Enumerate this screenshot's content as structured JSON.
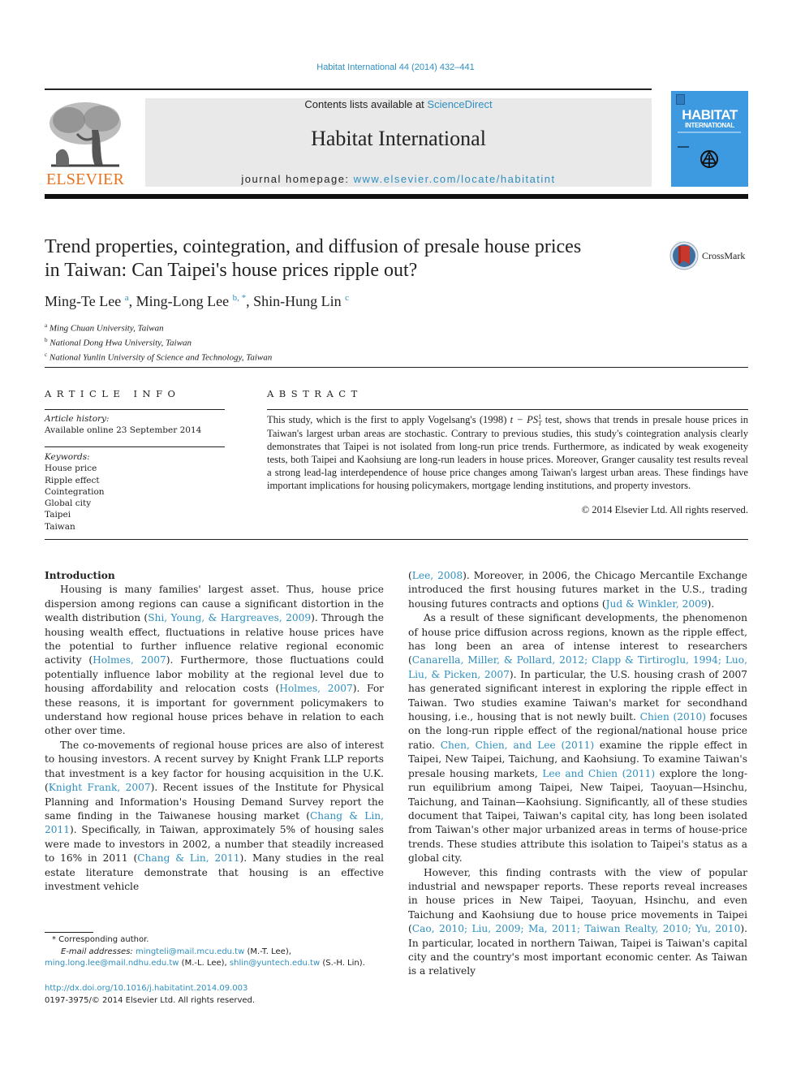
{
  "header": {
    "citation": "Habitat International 44 (2014) 432–441",
    "contents_prefix": "Contents lists available at ",
    "contents_link": "ScienceDirect",
    "journal_name": "Habitat International",
    "homepage_prefix": "journal homepage: ",
    "homepage_link": "www.elsevier.com/locate/habitatint",
    "publisher_logo": "ELSEVIER",
    "cover": {
      "title": "HABITAT",
      "subtitle": "INTERNATIONAL"
    }
  },
  "article": {
    "title": "Trend properties, cointegration, and diffusion of presale house prices in Taiwan: Can Taipei's house prices ripple out?",
    "crossmark_label": "CrossMark",
    "authors": [
      {
        "name": "Ming-Te Lee",
        "sup": "a"
      },
      {
        "name": "Ming-Long Lee",
        "sup": "b, *"
      },
      {
        "name": "Shin-Hung Lin",
        "sup": "c"
      }
    ],
    "affiliations": [
      {
        "sup": "a",
        "text": "Ming Chuan University, Taiwan"
      },
      {
        "sup": "b",
        "text": "National Dong Hwa University, Taiwan"
      },
      {
        "sup": "c",
        "text": "National Yunlin University of Science and Technology, Taiwan"
      }
    ]
  },
  "article_info": {
    "heading": "ARTICLE INFO",
    "history_label": "Article history:",
    "history_value": "Available online 23 September 2014",
    "keywords_label": "Keywords:",
    "keywords": [
      "House price",
      "Ripple effect",
      "Cointegration",
      "Global city",
      "Taipei",
      "Taiwan"
    ]
  },
  "abstract": {
    "heading": "ABSTRACT",
    "text_before": "This study, which is the first to apply Vogelsang's (1998) ",
    "math": "t − PS",
    "math_sup": "1",
    "math_sub": "T",
    "text_after": " test, shows that trends in presale house prices in Taiwan's largest urban areas are stochastic. Contrary to previous studies, this study's cointegration analysis clearly demonstrates that Taipei is not isolated from long-run price trends. Furthermore, as indicated by weak exogeneity tests, both Taipei and Kaohsiung are long-run leaders in house prices. Moreover, Granger causality test results reveal a strong lead-lag interdependence of house price changes among Taiwan's largest urban areas. These findings have important implications for housing policymakers, mortgage lending institutions, and property investors.",
    "copyright": "© 2014 Elsevier Ltd. All rights reserved."
  },
  "body": {
    "intro_heading": "Introduction",
    "p1": [
      {
        "t": "Housing is many families' largest asset. Thus, house price dispersion among regions can cause a significant distortion in the wealth distribution ("
      },
      {
        "l": "Shi, Young, & Hargreaves, 2009"
      },
      {
        "t": "). Through the housing wealth effect, fluctuations in relative house prices have the potential to further influence relative regional economic activity ("
      },
      {
        "l": "Holmes, 2007"
      },
      {
        "t": "). Furthermore, those fluctuations could potentially influence labor mobility at the regional level due to housing affordability and relocation costs ("
      },
      {
        "l": "Holmes, 2007"
      },
      {
        "t": "). For these reasons, it is important for government policymakers to understand how regional house prices behave in relation to each other over time."
      }
    ],
    "p2": [
      {
        "t": "The co-movements of regional house prices are also of interest to housing investors. A recent survey by Knight Frank LLP reports that investment is a key factor for housing acquisition in the U.K. ("
      },
      {
        "l": "Knight Frank, 2007"
      },
      {
        "t": "). Recent issues of the Institute for Physical Planning and Information's Housing Demand Survey report the same finding in the Taiwanese housing market ("
      },
      {
        "l": "Chang & Lin, 2011"
      },
      {
        "t": "). Specifically, in Taiwan, approximately 5% of housing sales were made to investors in 2002, a number that steadily increased to 16% in 2011 ("
      },
      {
        "l": "Chang & Lin, 2011"
      },
      {
        "t": "). Many studies in the real estate literature demonstrate that housing is an effective investment vehicle"
      }
    ],
    "p3": [
      {
        "t": "("
      },
      {
        "l": "Lee, 2008"
      },
      {
        "t": "). Moreover, in 2006, the Chicago Mercantile Exchange introduced the first housing futures market in the U.S., trading housing futures contracts and options ("
      },
      {
        "l": "Jud & Winkler, 2009"
      },
      {
        "t": ")."
      }
    ],
    "p4": [
      {
        "t": "As a result of these significant developments, the phenomenon of house price diffusion across regions, known as the ripple effect, has long been an area of intense interest to researchers ("
      },
      {
        "l": "Canarella, Miller, & Pollard, 2012; Clapp & Tirtiroglu, 1994; Luo, Liu, & Picken, 2007"
      },
      {
        "t": "). In particular, the U.S. housing crash of 2007 has generated significant interest in exploring the ripple effect in Taiwan. Two studies examine Taiwan's market for secondhand housing, i.e., housing that is not newly built. "
      },
      {
        "l": "Chien (2010)"
      },
      {
        "t": " focuses on the long-run ripple effect of the regional/national house price ratio. "
      },
      {
        "l": "Chen, Chien, and Lee (2011)"
      },
      {
        "t": " examine the ripple effect in Taipei, New Taipei, Taichung, and Kaohsiung. To examine Taiwan's presale housing markets, "
      },
      {
        "l": "Lee and Chien (2011)"
      },
      {
        "t": " explore the long-run equilibrium among Taipei, New Taipei, Taoyuan—Hsinchu, Taichung, and Tainan—Kaohsiung. Significantly, all of these studies document that Taipei, Taiwan's capital city, has long been isolated from Taiwan's other major urbanized areas in terms of house-price trends. These studies attribute this isolation to Taipei's status as a global city."
      }
    ],
    "p5": [
      {
        "t": "However, this finding contrasts with the view of popular industrial and newspaper reports. These reports reveal increases in house prices in New Taipei, Taoyuan, Hsinchu, and even Taichung and Kaohsiung due to house price movements in Taipei ("
      },
      {
        "l": "Cao, 2010; Liu, 2009; Ma, 2011; Taiwan Realty, 2010; Yu, 2010"
      },
      {
        "t": "). In particular, located in northern Taiwan, Taipei is Taiwan's capital city and the country's most important economic center. As Taiwan is a relatively"
      }
    ]
  },
  "footnotes": {
    "corresponding": "* Corresponding author.",
    "email_label": "E-mail addresses:",
    "emails": [
      {
        "addr": "mingteli@mail.mcu.edu.tw",
        "who": " (M.-T. Lee), "
      },
      {
        "addr": "ming.long.lee@mail.ndhu.edu.tw",
        "who": " (M.-L. Lee), "
      },
      {
        "addr": "shlin@yuntech.edu.tw",
        "who": " (S.-H. Lin)."
      }
    ],
    "doi": "http://dx.doi.org/10.1016/j.habitatint.2014.09.003",
    "issn": "0197-3975/© 2014 Elsevier Ltd. All rights reserved."
  },
  "colors": {
    "link": "#2e8fc0",
    "elsevier_orange": "#e8711c",
    "cover_blue": "#3d9ae0",
    "masthead_gray": "#e9e9e9"
  }
}
